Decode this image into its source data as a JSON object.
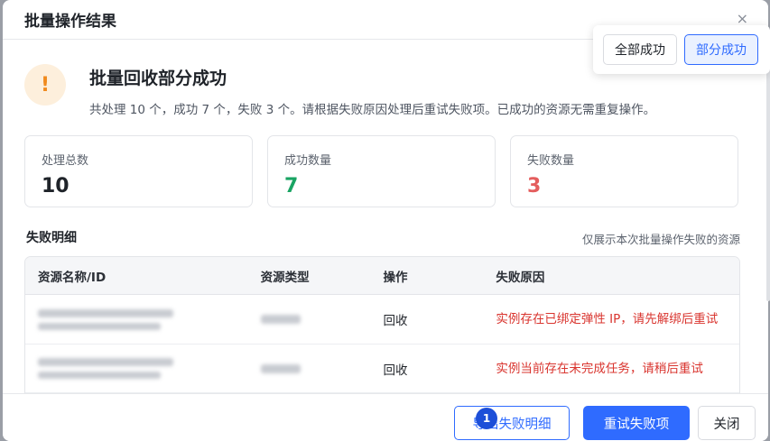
{
  "dialog": {
    "title": "批量操作结果",
    "close_glyph": "×"
  },
  "switcher": {
    "options": [
      {
        "label": "全部成功",
        "active": false
      },
      {
        "label": "部分成功",
        "active": true
      }
    ]
  },
  "result": {
    "icon": "warning-icon",
    "icon_glyph": "!",
    "title": "批量回收部分成功",
    "description": "共处理 10 个，成功 7 个，失败 3 个。请根据失败原因处理后重试失败项。已成功的资源无需重复操作。"
  },
  "stats": [
    {
      "label": "处理总数",
      "value": "10"
    },
    {
      "label": "成功数量",
      "value": "7"
    },
    {
      "label": "失败数量",
      "value": "3"
    }
  ],
  "failures": {
    "title": "失败明细",
    "hint": "仅展示本次批量操作失败的资源",
    "columns": [
      "资源名称/ID",
      "资源类型",
      "操作",
      "失败原因"
    ],
    "rows": [
      {
        "action": "回收",
        "reason": "实例存在已绑定弹性 IP，请先解绑后重试"
      },
      {
        "action": "回收",
        "reason": "实例当前存在未完成任务，请稍后重试"
      }
    ]
  },
  "footer": {
    "export_label": "导出失败明细",
    "badge_count": "1",
    "retry_label": "重试失败项",
    "close_label": "关闭"
  },
  "colors": {
    "primary": "#2f6bff",
    "success": "#19a463",
    "danger": "#d9352f",
    "warning": "#f08a1c"
  }
}
